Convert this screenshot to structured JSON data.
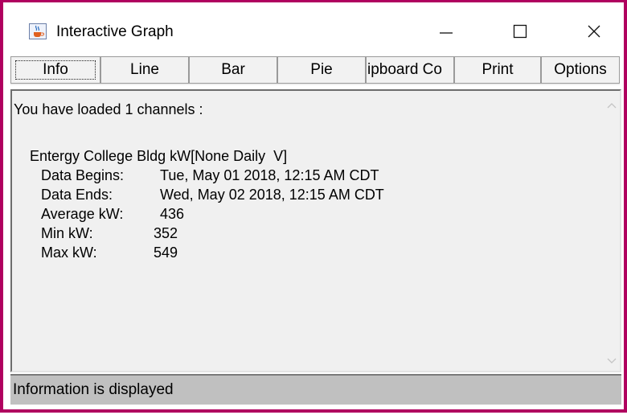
{
  "window": {
    "title": "Interactive Graph",
    "app_icon": "java-cup-icon",
    "controls": {
      "minimize": "minimize-icon",
      "maximize": "maximize-icon",
      "close": "close-icon"
    },
    "border_color": "#b0005f"
  },
  "toolbar": {
    "tabs": [
      {
        "label": "Info"
      },
      {
        "label": "Line"
      },
      {
        "label": "Bar"
      },
      {
        "label": "Pie"
      },
      {
        "label": "ipboard Co"
      },
      {
        "label": "Print"
      },
      {
        "label": "Options"
      }
    ]
  },
  "info": {
    "heading": "You have loaded 1 channels :",
    "channel_name": "Entergy College Bldg kW[None Daily  V]",
    "rows": [
      {
        "label": "Data Begins:",
        "value": "Tue, May 01 2018, 12:15 AM CDT"
      },
      {
        "label": "Data Ends:",
        "value": "Wed, May 02 2018, 12:15 AM CDT"
      },
      {
        "label": "Average kW:",
        "value": "436"
      },
      {
        "label": "Min kW:",
        "value": "352"
      },
      {
        "label": "Max kW:",
        "value": "549"
      }
    ]
  },
  "status": {
    "text": "Information is displayed"
  }
}
